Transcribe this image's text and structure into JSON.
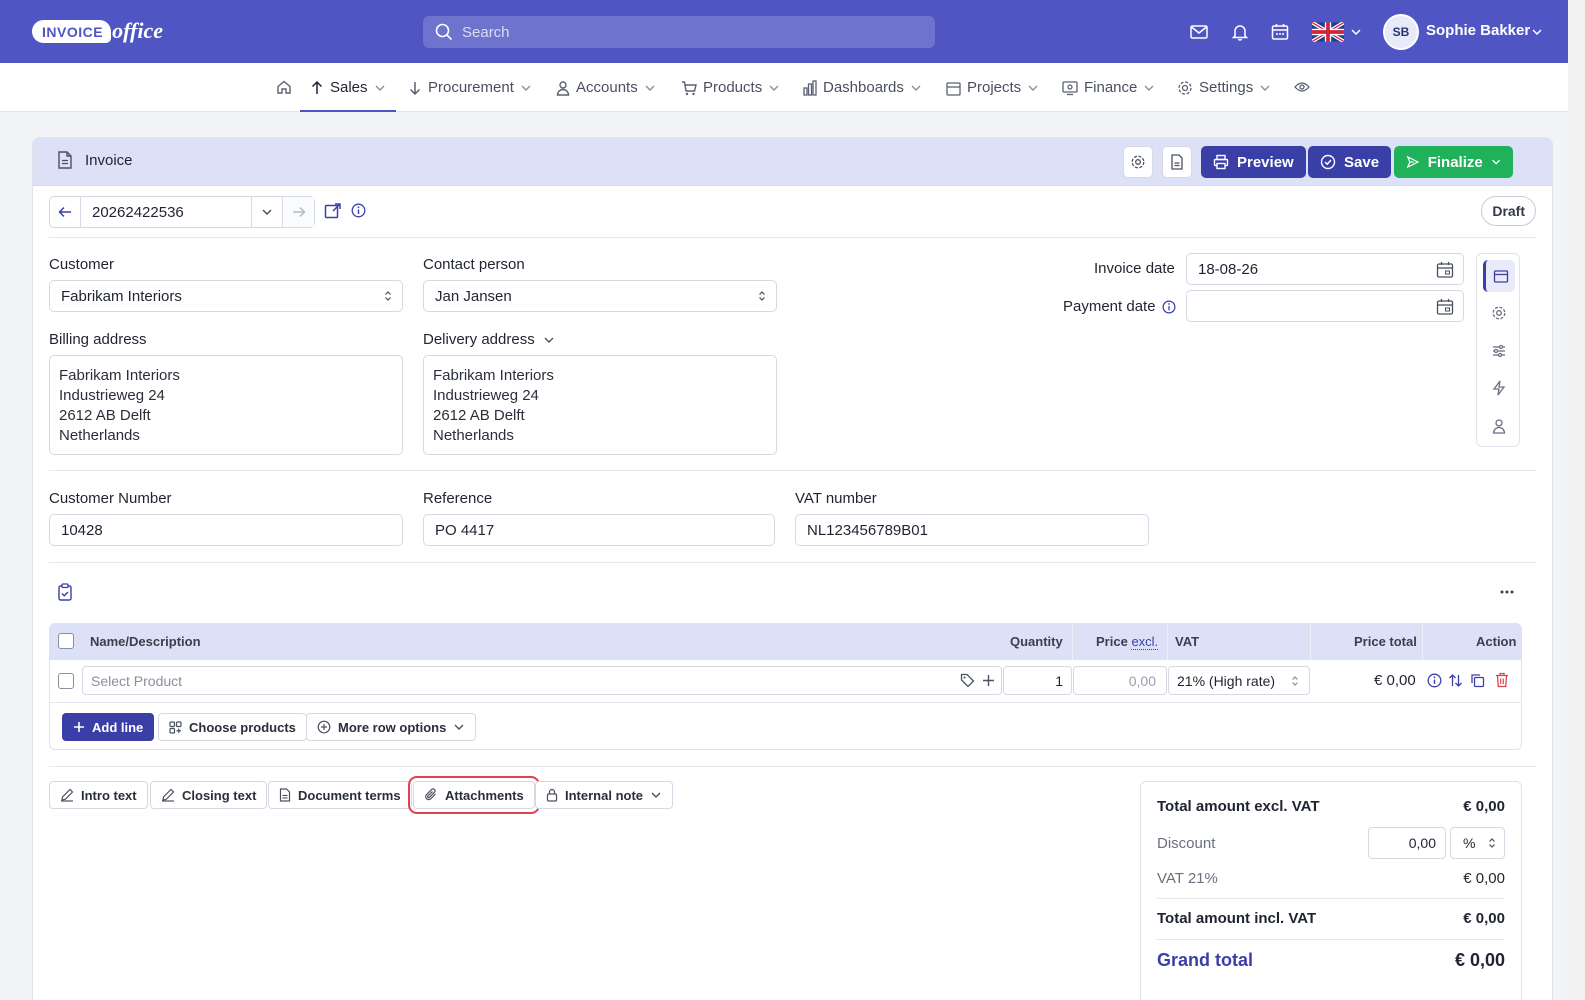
{
  "header": {
    "logo_main": "INVOICE",
    "logo_sub": "office",
    "search_placeholder": "Search",
    "user_initials": "SB",
    "user_name": "Sophie Bakker"
  },
  "nav": {
    "items": [
      {
        "label": "Sales",
        "active": true
      },
      {
        "label": "Procurement"
      },
      {
        "label": "Accounts"
      },
      {
        "label": "Products"
      },
      {
        "label": "Dashboards"
      },
      {
        "label": "Projects"
      },
      {
        "label": "Finance"
      },
      {
        "label": "Settings"
      }
    ]
  },
  "invoice": {
    "title": "Invoice",
    "preview_label": "Preview",
    "save_label": "Save",
    "finalize_label": "Finalize",
    "number": "20262422536",
    "status": "Draft",
    "customer_label": "Customer",
    "customer_value": "Fabrikam Interiors",
    "contact_label": "Contact person",
    "contact_value": "Jan Jansen",
    "billing_label": "Billing address",
    "billing_lines": [
      "Fabrikam Interiors",
      "Industrieweg 24",
      "2612 AB Delft",
      "Netherlands"
    ],
    "delivery_label": "Delivery address",
    "delivery_lines": [
      "Fabrikam Interiors",
      "Industrieweg 24",
      "2612 AB Delft",
      "Netherlands"
    ],
    "invoice_date_label": "Invoice date",
    "invoice_date_value": "18-08-26",
    "payment_date_label": "Payment date",
    "payment_date_value": "",
    "customer_number_label": "Customer Number",
    "customer_number_value": "10428",
    "reference_label": "Reference",
    "reference_value": "PO 4417",
    "vat_number_label": "VAT number",
    "vat_number_value": "NL123456789B01"
  },
  "lines": {
    "columns": {
      "name": "Name/Description",
      "quantity": "Quantity",
      "price": "Price",
      "price_suffix": "excl.",
      "vat": "VAT",
      "price_total": "Price total",
      "action": "Action"
    },
    "rows": [
      {
        "product_placeholder": "Select Product",
        "quantity": "1",
        "price_placeholder": "0,00",
        "vat": "21% (High rate)",
        "total": "€ 0,00"
      }
    ],
    "add_line_label": "Add line",
    "choose_products_label": "Choose products",
    "more_row_options_label": "More row options"
  },
  "text_buttons": {
    "intro": "Intro text",
    "closing": "Closing text",
    "terms": "Document terms",
    "attachments": "Attachments",
    "internal_note": "Internal note"
  },
  "totals": {
    "excl_label": "Total amount excl. VAT",
    "excl_value": "€ 0,00",
    "discount_label": "Discount",
    "discount_value": "0,00",
    "discount_unit": "%",
    "vat_label": "VAT 21%",
    "vat_value": "€ 0,00",
    "incl_label": "Total amount incl. VAT",
    "incl_value": "€ 0,00",
    "grand_label": "Grand total",
    "grand_value": "€ 0,00"
  },
  "colors": {
    "brand": "#4f56c4",
    "primary_button": "#3a3fa8",
    "finalize_button": "#20b25a",
    "header_band": "#dde1f7",
    "highlight_outline": "#e0424d"
  }
}
